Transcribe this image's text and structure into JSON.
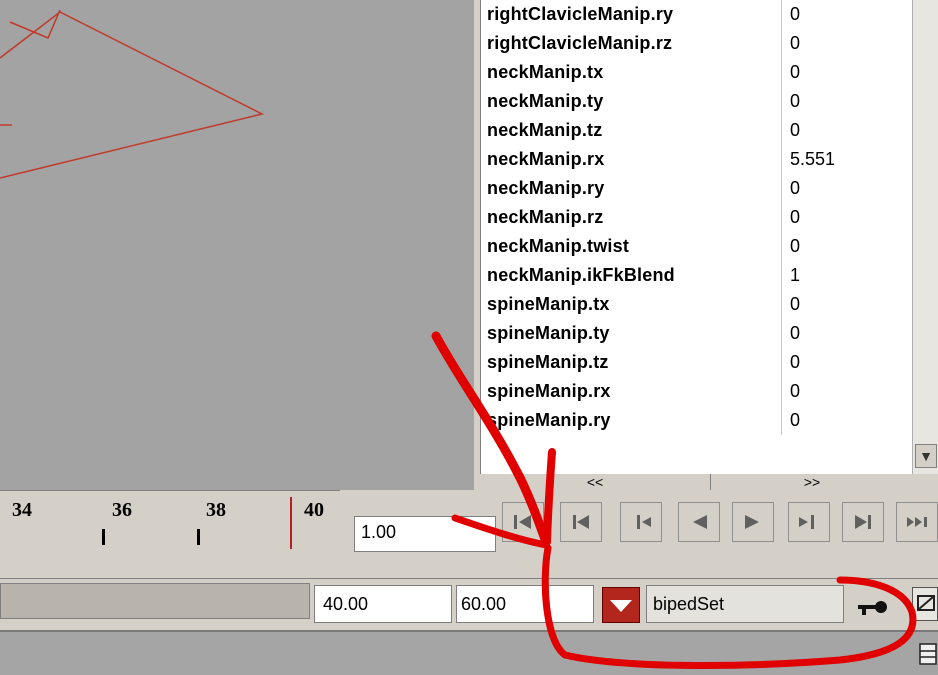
{
  "channel_box": {
    "rows": [
      {
        "name": "rightClavicleManip.ry",
        "value": "0"
      },
      {
        "name": "rightClavicleManip.rz",
        "value": "0"
      },
      {
        "name": "neckManip.tx",
        "value": "0"
      },
      {
        "name": "neckManip.ty",
        "value": "0"
      },
      {
        "name": "neckManip.tz",
        "value": "0"
      },
      {
        "name": "neckManip.rx",
        "value": "5.551"
      },
      {
        "name": "neckManip.ry",
        "value": "0"
      },
      {
        "name": "neckManip.rz",
        "value": "0"
      },
      {
        "name": "neckManip.twist",
        "value": "0"
      },
      {
        "name": "neckManip.ikFkBlend",
        "value": "1"
      },
      {
        "name": "spineManip.tx",
        "value": "0"
      },
      {
        "name": "spineManip.ty",
        "value": "0"
      },
      {
        "name": "spineManip.tz",
        "value": "0"
      },
      {
        "name": "spineManip.rx",
        "value": "0"
      },
      {
        "name": "spineManip.ry",
        "value": "0"
      }
    ],
    "scroll_left_label": "<<",
    "scroll_right_label": ">>"
  },
  "timeline": {
    "ticks": [
      "34",
      "36",
      "38",
      "40"
    ],
    "current_frame": "1.00"
  },
  "range": {
    "end_time": "40.00",
    "max_time": "60.00",
    "character_set": "bipedSet"
  },
  "icons": {
    "scroll_down": "chevron-down-icon",
    "key": "key-icon",
    "prefs": "animation-prefs-icon",
    "menu": "menu-icon"
  },
  "colors": {
    "viewport": "#a3a3a3",
    "wire": "#c0392b",
    "annotation": "#e00000",
    "key_button": "#b3261e"
  }
}
